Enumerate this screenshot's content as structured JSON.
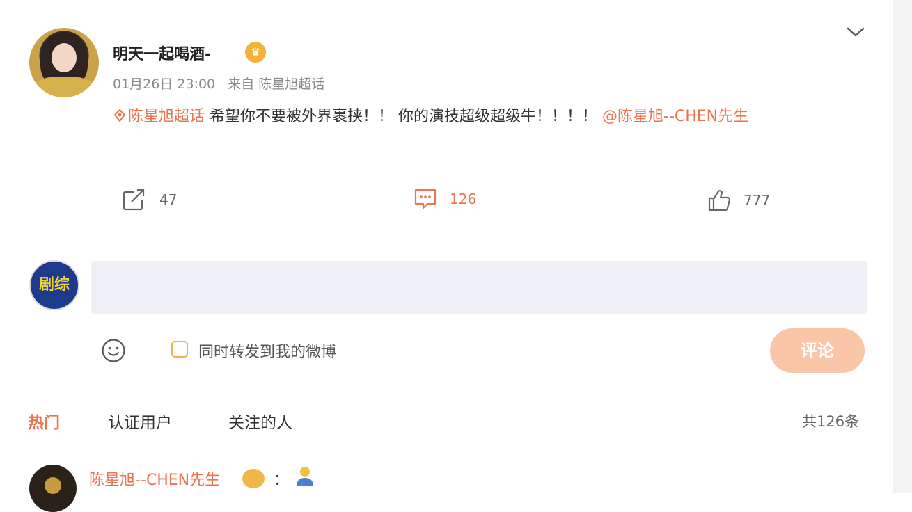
{
  "post": {
    "username": "明天一起喝酒-",
    "crown_icon": "crown-badge-icon",
    "date": "01月26日 23:00",
    "source": "来自 陈星旭超话",
    "topic": "陈星旭超话",
    "text_main": " 希望你不要被外界裹挟！！ 你的演技超级超级牛！！！！ ",
    "mention": "@陈星旭--CHEN先生",
    "repost_count": "47",
    "comment_count": "126",
    "like_count": "777"
  },
  "composer": {
    "avatar_text": "剧综",
    "input_value": "",
    "repost_label": "同时转发到我的微博",
    "submit_label": "评论"
  },
  "tabs": [
    {
      "label": "热门"
    },
    {
      "label": "认证用户"
    },
    {
      "label": "关注的人"
    }
  ],
  "total_label": "共126条",
  "reply": {
    "name": "陈星旭--CHEN先生",
    "colon": "："
  },
  "colors": {
    "accent": "#eb7350",
    "submit_disabled": "#f9c6a8",
    "input_bg": "#eef0f5"
  }
}
